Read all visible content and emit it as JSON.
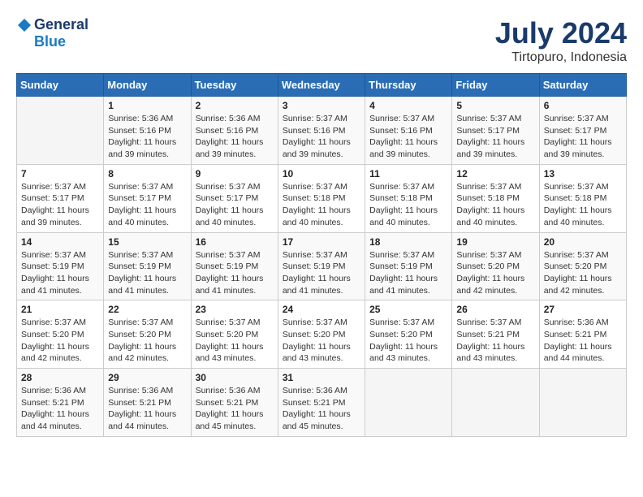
{
  "header": {
    "logo_line1": "General",
    "logo_line2": "Blue",
    "month_year": "July 2024",
    "location": "Tirtopuro, Indonesia"
  },
  "weekdays": [
    "Sunday",
    "Monday",
    "Tuesday",
    "Wednesday",
    "Thursday",
    "Friday",
    "Saturday"
  ],
  "weeks": [
    [
      {
        "day": "",
        "sunrise": "",
        "sunset": "",
        "daylight": ""
      },
      {
        "day": "1",
        "sunrise": "Sunrise: 5:36 AM",
        "sunset": "Sunset: 5:16 PM",
        "daylight": "Daylight: 11 hours and 39 minutes."
      },
      {
        "day": "2",
        "sunrise": "Sunrise: 5:36 AM",
        "sunset": "Sunset: 5:16 PM",
        "daylight": "Daylight: 11 hours and 39 minutes."
      },
      {
        "day": "3",
        "sunrise": "Sunrise: 5:37 AM",
        "sunset": "Sunset: 5:16 PM",
        "daylight": "Daylight: 11 hours and 39 minutes."
      },
      {
        "day": "4",
        "sunrise": "Sunrise: 5:37 AM",
        "sunset": "Sunset: 5:16 PM",
        "daylight": "Daylight: 11 hours and 39 minutes."
      },
      {
        "day": "5",
        "sunrise": "Sunrise: 5:37 AM",
        "sunset": "Sunset: 5:17 PM",
        "daylight": "Daylight: 11 hours and 39 minutes."
      },
      {
        "day": "6",
        "sunrise": "Sunrise: 5:37 AM",
        "sunset": "Sunset: 5:17 PM",
        "daylight": "Daylight: 11 hours and 39 minutes."
      }
    ],
    [
      {
        "day": "7",
        "sunrise": "Sunrise: 5:37 AM",
        "sunset": "Sunset: 5:17 PM",
        "daylight": "Daylight: 11 hours and 39 minutes."
      },
      {
        "day": "8",
        "sunrise": "Sunrise: 5:37 AM",
        "sunset": "Sunset: 5:17 PM",
        "daylight": "Daylight: 11 hours and 40 minutes."
      },
      {
        "day": "9",
        "sunrise": "Sunrise: 5:37 AM",
        "sunset": "Sunset: 5:17 PM",
        "daylight": "Daylight: 11 hours and 40 minutes."
      },
      {
        "day": "10",
        "sunrise": "Sunrise: 5:37 AM",
        "sunset": "Sunset: 5:18 PM",
        "daylight": "Daylight: 11 hours and 40 minutes."
      },
      {
        "day": "11",
        "sunrise": "Sunrise: 5:37 AM",
        "sunset": "Sunset: 5:18 PM",
        "daylight": "Daylight: 11 hours and 40 minutes."
      },
      {
        "day": "12",
        "sunrise": "Sunrise: 5:37 AM",
        "sunset": "Sunset: 5:18 PM",
        "daylight": "Daylight: 11 hours and 40 minutes."
      },
      {
        "day": "13",
        "sunrise": "Sunrise: 5:37 AM",
        "sunset": "Sunset: 5:18 PM",
        "daylight": "Daylight: 11 hours and 40 minutes."
      }
    ],
    [
      {
        "day": "14",
        "sunrise": "Sunrise: 5:37 AM",
        "sunset": "Sunset: 5:19 PM",
        "daylight": "Daylight: 11 hours and 41 minutes."
      },
      {
        "day": "15",
        "sunrise": "Sunrise: 5:37 AM",
        "sunset": "Sunset: 5:19 PM",
        "daylight": "Daylight: 11 hours and 41 minutes."
      },
      {
        "day": "16",
        "sunrise": "Sunrise: 5:37 AM",
        "sunset": "Sunset: 5:19 PM",
        "daylight": "Daylight: 11 hours and 41 minutes."
      },
      {
        "day": "17",
        "sunrise": "Sunrise: 5:37 AM",
        "sunset": "Sunset: 5:19 PM",
        "daylight": "Daylight: 11 hours and 41 minutes."
      },
      {
        "day": "18",
        "sunrise": "Sunrise: 5:37 AM",
        "sunset": "Sunset: 5:19 PM",
        "daylight": "Daylight: 11 hours and 41 minutes."
      },
      {
        "day": "19",
        "sunrise": "Sunrise: 5:37 AM",
        "sunset": "Sunset: 5:20 PM",
        "daylight": "Daylight: 11 hours and 42 minutes."
      },
      {
        "day": "20",
        "sunrise": "Sunrise: 5:37 AM",
        "sunset": "Sunset: 5:20 PM",
        "daylight": "Daylight: 11 hours and 42 minutes."
      }
    ],
    [
      {
        "day": "21",
        "sunrise": "Sunrise: 5:37 AM",
        "sunset": "Sunset: 5:20 PM",
        "daylight": "Daylight: 11 hours and 42 minutes."
      },
      {
        "day": "22",
        "sunrise": "Sunrise: 5:37 AM",
        "sunset": "Sunset: 5:20 PM",
        "daylight": "Daylight: 11 hours and 42 minutes."
      },
      {
        "day": "23",
        "sunrise": "Sunrise: 5:37 AM",
        "sunset": "Sunset: 5:20 PM",
        "daylight": "Daylight: 11 hours and 43 minutes."
      },
      {
        "day": "24",
        "sunrise": "Sunrise: 5:37 AM",
        "sunset": "Sunset: 5:20 PM",
        "daylight": "Daylight: 11 hours and 43 minutes."
      },
      {
        "day": "25",
        "sunrise": "Sunrise: 5:37 AM",
        "sunset": "Sunset: 5:20 PM",
        "daylight": "Daylight: 11 hours and 43 minutes."
      },
      {
        "day": "26",
        "sunrise": "Sunrise: 5:37 AM",
        "sunset": "Sunset: 5:21 PM",
        "daylight": "Daylight: 11 hours and 43 minutes."
      },
      {
        "day": "27",
        "sunrise": "Sunrise: 5:36 AM",
        "sunset": "Sunset: 5:21 PM",
        "daylight": "Daylight: 11 hours and 44 minutes."
      }
    ],
    [
      {
        "day": "28",
        "sunrise": "Sunrise: 5:36 AM",
        "sunset": "Sunset: 5:21 PM",
        "daylight": "Daylight: 11 hours and 44 minutes."
      },
      {
        "day": "29",
        "sunrise": "Sunrise: 5:36 AM",
        "sunset": "Sunset: 5:21 PM",
        "daylight": "Daylight: 11 hours and 44 minutes."
      },
      {
        "day": "30",
        "sunrise": "Sunrise: 5:36 AM",
        "sunset": "Sunset: 5:21 PM",
        "daylight": "Daylight: 11 hours and 45 minutes."
      },
      {
        "day": "31",
        "sunrise": "Sunrise: 5:36 AM",
        "sunset": "Sunset: 5:21 PM",
        "daylight": "Daylight: 11 hours and 45 minutes."
      },
      {
        "day": "",
        "sunrise": "",
        "sunset": "",
        "daylight": ""
      },
      {
        "day": "",
        "sunrise": "",
        "sunset": "",
        "daylight": ""
      },
      {
        "day": "",
        "sunrise": "",
        "sunset": "",
        "daylight": ""
      }
    ]
  ]
}
